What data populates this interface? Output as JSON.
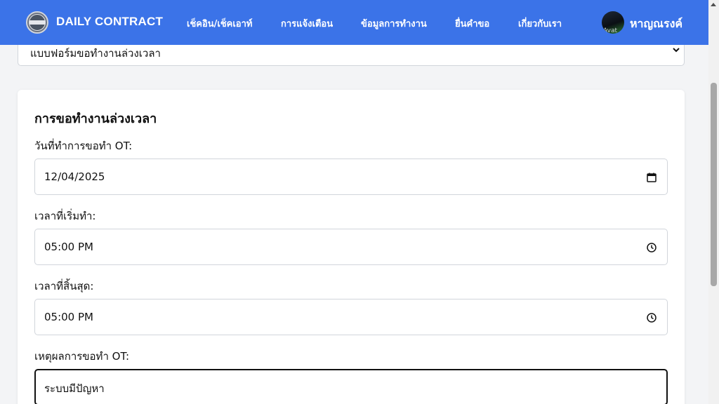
{
  "navbar": {
    "brand": "DAILY CONTRACT",
    "items": [
      {
        "label": "เช็คอิน/เช็คเอาท์"
      },
      {
        "label": "การแจ้งเตือน"
      },
      {
        "label": "ข้อมูลการทำงาน"
      },
      {
        "label": "ยื่นคำขอ"
      },
      {
        "label": "เกี่ยวกับเรา"
      }
    ],
    "avatar_text": "Avat",
    "username": "หาญณรงค์",
    "colors": {
      "background": "#3b73e8",
      "text": "#ffffff"
    }
  },
  "form_type_select": {
    "selected": "แบบฟอร์มขอทำงานล่วงเวลา"
  },
  "ot_form": {
    "title": "การขอทำงานล่วงเวลา",
    "date_label": "วันที่ทำการขอทำ OT:",
    "date_value": "12/04/2025",
    "start_label": "เวลาที่เริ่มทำ:",
    "start_value": "05:00 PM",
    "end_label": "เวลาที่สิ้นสุด:",
    "end_value": "05:00 PM",
    "reason_label": "เหตุผลการขอทำ OT:",
    "reason_value": "ระบบมีปัญหา"
  },
  "icons": {
    "logo": "contract-logo-icon",
    "calendar": "calendar-icon",
    "clock": "clock-icon",
    "chevron": "chevron-down-icon"
  }
}
